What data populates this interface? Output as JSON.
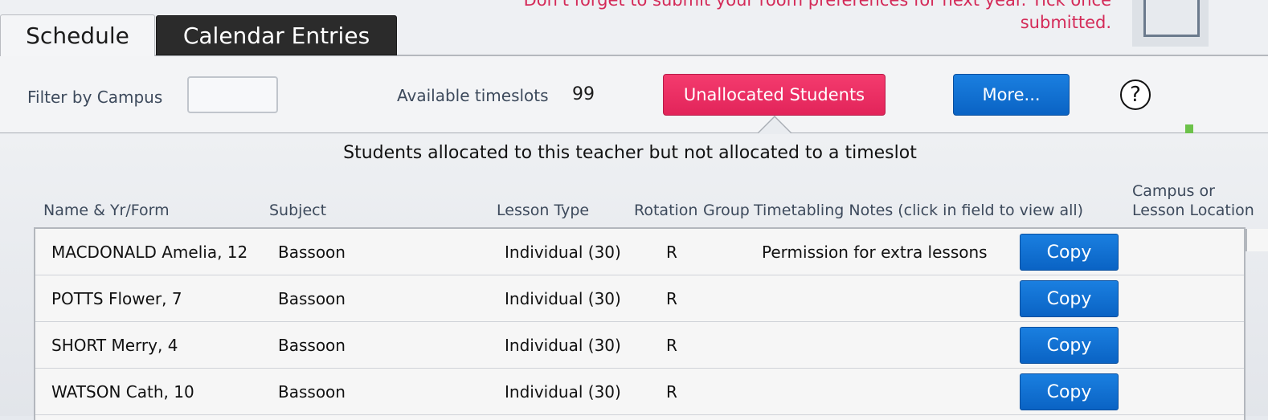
{
  "tabs": {
    "schedule": "Schedule",
    "calendar": "Calendar Entries"
  },
  "notice": {
    "line1": "Don't forget to submit your room preferences for next year. Tick once",
    "line2": "submitted."
  },
  "toolbar": {
    "filter_label": "Filter by Campus",
    "filter_value": "",
    "slots_label": "Available timeslots",
    "slots_value": "99",
    "unallocated_label": "Unallocated Students",
    "more_label": "More...",
    "help_glyph": "?"
  },
  "panel": {
    "title": "Students allocated to this teacher but not allocated to a timeslot",
    "columns": {
      "name": "Name & Yr/Form",
      "subject": "Subject",
      "lesson_type": "Lesson Type",
      "rotation": "Rotation",
      "group": "Group",
      "notes": "Timetabling Notes (click in field to view all)",
      "location_line1": "Campus or",
      "location_line2": "Lesson Location"
    },
    "copy_label": "Copy",
    "rows": [
      {
        "name": "MACDONALD Amelia, 12",
        "subject": "Bassoon",
        "lesson_type": "Individual (30)",
        "rotation": "R",
        "notes": "Permission for extra lessons"
      },
      {
        "name": "POTTS Flower, 7",
        "subject": "Bassoon",
        "lesson_type": "Individual (30)",
        "rotation": "R",
        "notes": ""
      },
      {
        "name": "SHORT Merry, 4",
        "subject": "Bassoon",
        "lesson_type": "Individual (30)",
        "rotation": "R",
        "notes": ""
      },
      {
        "name": "WATSON Cath, 10",
        "subject": "Bassoon",
        "lesson_type": "Individual (30)",
        "rotation": "R",
        "notes": ""
      }
    ]
  },
  "colors": {
    "accent_pink": "#e2245a",
    "accent_blue": "#0a63c4",
    "notice_text": "#d42a58"
  }
}
